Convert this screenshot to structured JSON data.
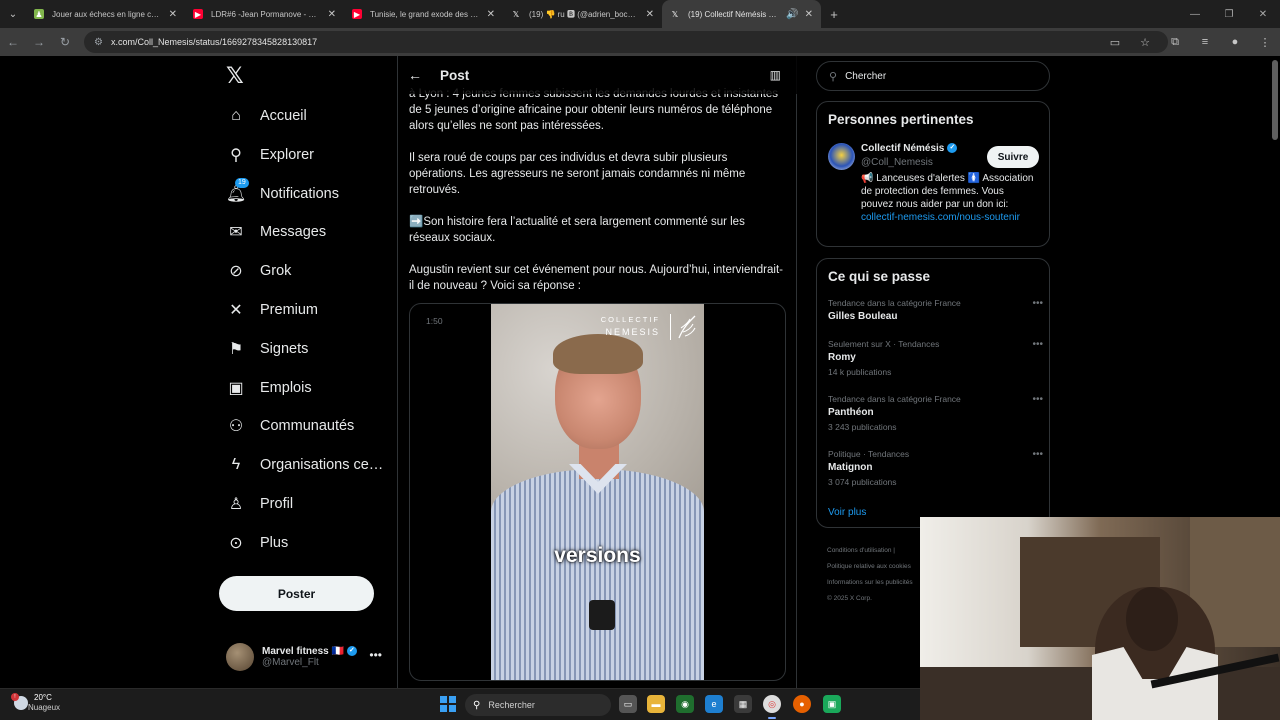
{
  "browser": {
    "tabs": [
      {
        "title": "Jouer aux échecs en ligne contre…",
        "color": "#81b64c",
        "icon": "chess-pawn-icon"
      },
      {
        "title": "LDR#6 -Jean Pormanove - Enqu…",
        "color": "#ff0033",
        "icon": "youtube-icon"
      },
      {
        "title": "Tunisie, le grand exode des mé…",
        "color": "#ff0033",
        "icon": "youtube-icon"
      },
      {
        "title": "(19) 👎 ru 🅱 (@adrien_bocque…",
        "color": "#000000",
        "icon": "x-icon"
      },
      {
        "title": "(19) Collectif Némésis sur X",
        "color": "#000000",
        "icon": "x-icon",
        "active": true
      }
    ],
    "url": "x.com/Coll_Nemesis/status/1669278345828130817"
  },
  "nav": {
    "items": [
      {
        "label": "Accueil",
        "icon": "home-icon"
      },
      {
        "label": "Explorer",
        "icon": "search-icon"
      },
      {
        "label": "Notifications",
        "icon": "bell-icon",
        "badge": "19"
      },
      {
        "label": "Messages",
        "icon": "mail-icon"
      },
      {
        "label": "Grok",
        "icon": "grok-icon"
      },
      {
        "label": "Premium",
        "icon": "x-icon"
      },
      {
        "label": "Signets",
        "icon": "bookmark-icon"
      },
      {
        "label": "Emplois",
        "icon": "briefcase-icon"
      },
      {
        "label": "Communautés",
        "icon": "communities-icon"
      },
      {
        "label": "Organisations ce…",
        "icon": "lightning-icon"
      },
      {
        "label": "Profil",
        "icon": "person-icon"
      },
      {
        "label": "Plus",
        "icon": "more-circle-icon"
      }
    ],
    "post_button": "Poster",
    "account": {
      "name": "Marvel fitness 🇫🇷",
      "handle": "@Marvel_Flt"
    }
  },
  "post": {
    "header": "Post",
    "paragraphs": [
      "à Lyon : 4 jeunes femmes subissent les demandes lourdes et insistantes de 5 jeunes d’origine africaine pour obtenir leurs numéros de téléphone alors qu’elles ne sont pas intéressées.",
      "Il sera roué de coups par ces individus et devra subir plusieurs opérations. Les agresseurs ne seront jamais condamnés ni même retrouvés.",
      "➡️Son histoire fera l’actualité et sera largement commenté sur les réseaux sociaux.",
      "Augustin revient sur cet événement pour nous. Aujourd’hui, interviendrait-il de nouveau ? Voici sa réponse :"
    ],
    "video": {
      "time": "1:50",
      "brand_line1": "COLLECTIF",
      "brand_line2": "NEMESIS",
      "caption": "versions"
    }
  },
  "sidebar": {
    "search_placeholder": "Chercher",
    "relevant": {
      "title": "Personnes pertinentes",
      "name": "Collectif Némésis",
      "handle": "@Coll_Nemesis",
      "follow": "Suivre",
      "bio": "📢 Lanceuses d'alertes 🚺 Association de protection des femmes. Vous pouvez nous aider par un don ici: ",
      "bio_link": "collectif-nemesis.com/nous-soutenir"
    },
    "trends": {
      "title": "Ce qui se passe",
      "items": [
        {
          "context": "Tendance dans la catégorie France",
          "name": "Gilles Bouleau",
          "count": ""
        },
        {
          "context": "Seulement sur X · Tendances",
          "name": "Romy",
          "count": "14 k publications"
        },
        {
          "context": "Tendance dans la catégorie France",
          "name": "Panthéon",
          "count": "3 243 publications"
        },
        {
          "context": "Politique · Tendances",
          "name": "Matignon",
          "count": "3 074 publications"
        }
      ],
      "more": "Voir plus"
    },
    "footer": [
      "Conditions d'utilisation  |",
      "Politique relative aux cookies",
      "Informations sur les publicités",
      "© 2025 X Corp."
    ]
  },
  "taskbar": {
    "temperature": "20°C",
    "condition": "Nuageux",
    "search": "Rechercher"
  }
}
